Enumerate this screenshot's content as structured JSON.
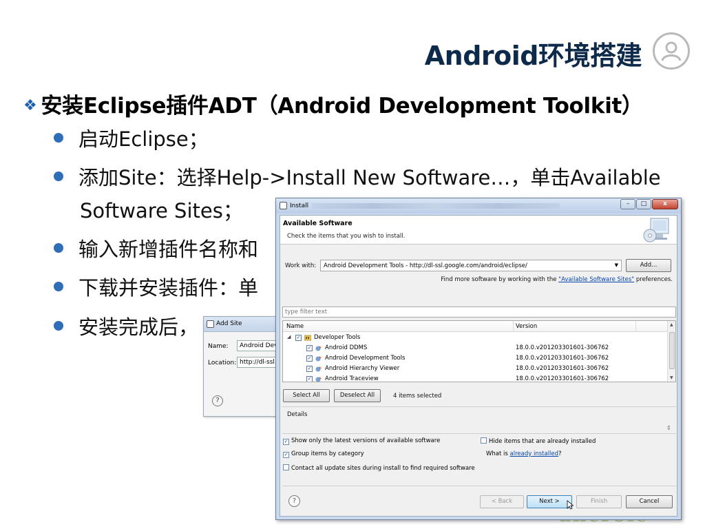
{
  "slide": {
    "title": "Android环境搭建",
    "heading": "安装Eclipse插件ADT（Android Development Toolkit）",
    "bullets": [
      "启动Eclipse；",
      "添加Site：选择Help->Install New Software…，单击Available",
      "Software Sites；",
      "输入新增插件名称和",
      "下载并安装插件：单",
      "安装完成后，"
    ],
    "footer_logo": "ancroic"
  },
  "add_site": {
    "title": "Add Site",
    "name_label": "Name:",
    "name_value": "Android Dev",
    "location_label": "Location:",
    "location_value": "http://dl-ssl.",
    "help": "?"
  },
  "install": {
    "window_title": "Install",
    "win_controls": {
      "minimize": "–",
      "maximize": "□",
      "close": "x"
    },
    "banner_title": "Available Software",
    "banner_subtitle": "Check the items that you wish to install.",
    "work_with_label": "Work with:",
    "work_with_value": "Android Development Tools - http://dl-ssl.google.com/android/eclipse/",
    "add_button": "Add...",
    "find_more_prefix": "Find more software by working with the ",
    "find_more_link": "\"Available Software Sites\"",
    "find_more_suffix": " preferences.",
    "filter_placeholder": "type filter text",
    "columns": {
      "name": "Name",
      "version": "Version"
    },
    "tree": [
      {
        "level": 0,
        "name": "Developer Tools",
        "version": "",
        "checked": true
      },
      {
        "level": 1,
        "name": "Android DDMS",
        "version": "18.0.0.v201203301601-306762",
        "checked": true
      },
      {
        "level": 1,
        "name": "Android Development Tools",
        "version": "18.0.0.v201203301601-306762",
        "checked": true
      },
      {
        "level": 1,
        "name": "Android Hierarchy Viewer",
        "version": "18.0.0.v201203301601-306762",
        "checked": true
      },
      {
        "level": 1,
        "name": "Android Traceview",
        "version": "18.0.0.v201203301601-306762",
        "checked": true
      }
    ],
    "select_all": "Select All",
    "deselect_all": "Deselect All",
    "selected_count": "4 items selected",
    "details_label": "Details",
    "options": {
      "show_latest": {
        "label": "Show only the latest versions of available software",
        "checked": true
      },
      "hide_installed": {
        "label": "Hide items that are already installed",
        "checked": false
      },
      "group_by_category": {
        "label": "Group items by category",
        "checked": true
      },
      "what_is_prefix": "What is ",
      "what_is_link": "already installed",
      "what_is_suffix": "?",
      "contact_sites": {
        "label": "Contact all update sites during install to find required software",
        "checked": false
      }
    },
    "buttons": {
      "help": "?",
      "back": "< Back",
      "next": "Next >",
      "finish": "Finish",
      "cancel": "Cancel"
    }
  }
}
